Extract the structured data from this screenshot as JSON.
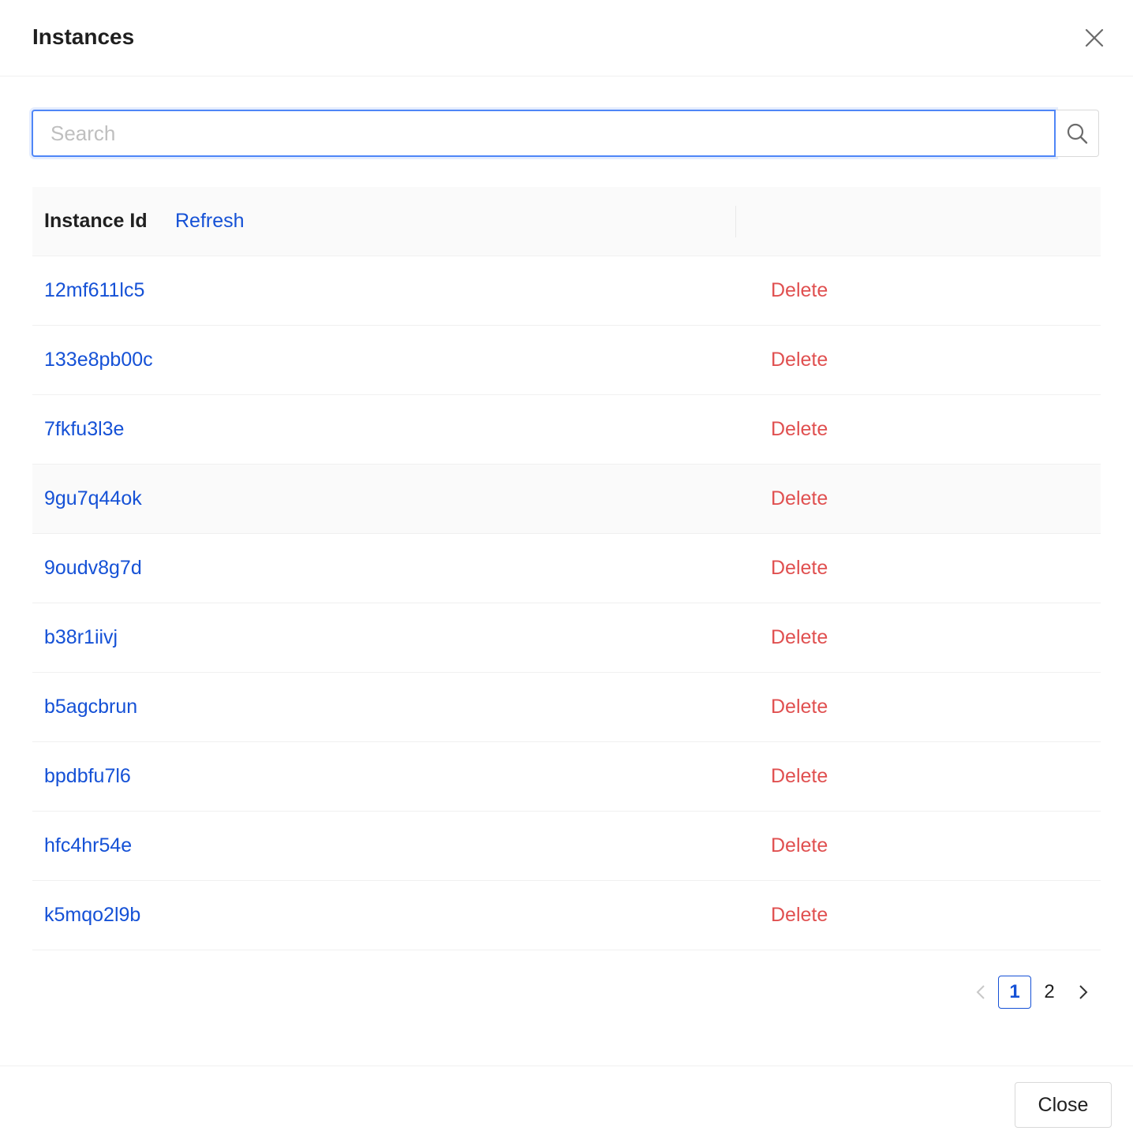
{
  "modal": {
    "title": "Instances",
    "close_icon": "close-icon"
  },
  "search": {
    "placeholder": "Search",
    "value": "",
    "button_icon": "search-icon"
  },
  "table": {
    "header": {
      "column_label": "Instance Id",
      "refresh_label": "Refresh"
    },
    "rows": [
      {
        "id": "12mf611lc5",
        "action": "Delete"
      },
      {
        "id": "133e8pb00c",
        "action": "Delete"
      },
      {
        "id": "7fkfu3l3e",
        "action": "Delete"
      },
      {
        "id": "9gu7q44ok",
        "action": "Delete"
      },
      {
        "id": "9oudv8g7d",
        "action": "Delete"
      },
      {
        "id": "b38r1iivj",
        "action": "Delete"
      },
      {
        "id": "b5agcbrun",
        "action": "Delete"
      },
      {
        "id": "bpdbfu7l6",
        "action": "Delete"
      },
      {
        "id": "hfc4hr54e",
        "action": "Delete"
      },
      {
        "id": "k5mqo2l9b",
        "action": "Delete"
      }
    ]
  },
  "pagination": {
    "pages": [
      "1",
      "2"
    ],
    "current": "1",
    "prev_icon": "chevron-left-icon",
    "next_icon": "chevron-right-icon"
  },
  "footer": {
    "close_label": "Close"
  },
  "colors": {
    "link": "#1551d6",
    "danger": "#e05050",
    "focus": "#4f86f7"
  }
}
